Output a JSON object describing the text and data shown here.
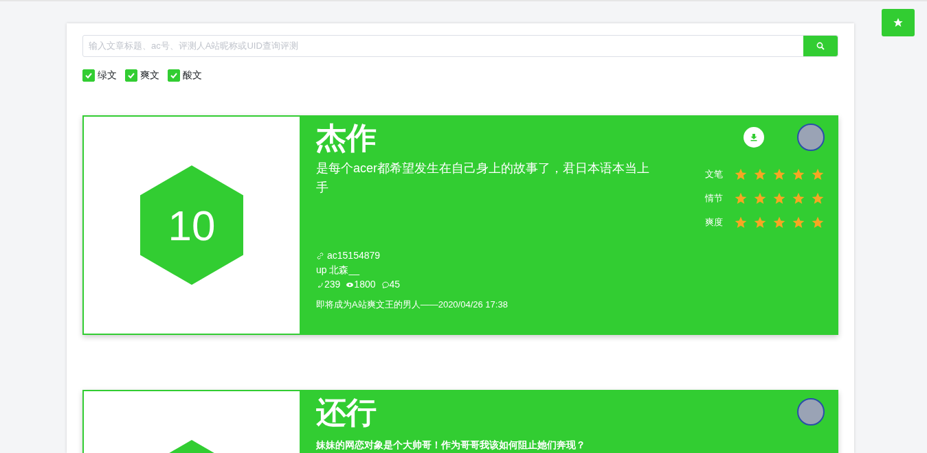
{
  "search": {
    "placeholder": "输入文章标题、ac号、评测人A站昵称或UID查询评测"
  },
  "filters": [
    {
      "label": "绿文",
      "checked": true
    },
    {
      "label": "爽文",
      "checked": true
    },
    {
      "label": "酸文",
      "checked": true
    }
  ],
  "reviews": [
    {
      "score": "10",
      "title": "杰作",
      "desc": "是每个acer都希望发生在自己身上的故事了，君日本语本当上手",
      "desc_bold": false,
      "download": true,
      "ratings": [
        {
          "label": "文笔",
          "stars": 5
        },
        {
          "label": "情节",
          "stars": 5
        },
        {
          "label": "爽度",
          "stars": 5
        }
      ],
      "ac": "ac15154879",
      "up": "up 北森__",
      "likes": "239",
      "views": "1800",
      "comments": "45",
      "footer": "即将成为A站爽文王的男人——2020/04/26 17:38"
    },
    {
      "title": "还行",
      "desc": "妹妹的网恋对象是个大帅哥！作为哥哥我该如何阻止她们奔现？",
      "desc_bold": true,
      "download": false
    }
  ]
}
